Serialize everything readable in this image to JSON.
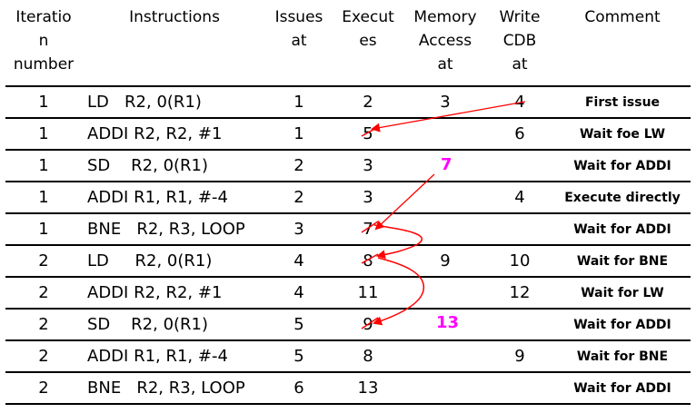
{
  "columns": [
    "Iteratio\nn\nnumber",
    "Instructions",
    "Issues\nat",
    "Execut\nes",
    "Memory\nAccess\nat",
    "Write\nCDB\nat",
    "Comment"
  ],
  "rows": [
    {
      "iter": "1",
      "instr": "LD   R2, 0(R1)",
      "issue": "1",
      "exec": "2",
      "mem": "3",
      "cdb": "4",
      "comment": "First issue"
    },
    {
      "iter": "1",
      "instr": "ADDI R2, R2, #1",
      "issue": "1",
      "exec": "5",
      "mem": "",
      "cdb": "6",
      "comment": "Wait foe LW"
    },
    {
      "iter": "1",
      "instr": "SD    R2, 0(R1)",
      "issue": "2",
      "exec": "3",
      "mem": "",
      "cdb": "",
      "comment": "Wait for ADDI"
    },
    {
      "iter": "1",
      "instr": "ADDI R1, R1, #-4",
      "issue": "2",
      "exec": "3",
      "mem": "",
      "cdb": "4",
      "comment": "Execute directly"
    },
    {
      "iter": "1",
      "instr": "BNE   R2, R3, LOOP",
      "issue": "3",
      "exec": "7",
      "mem": "",
      "cdb": "",
      "comment": "Wait for ADDI"
    },
    {
      "iter": "2",
      "instr": "LD     R2, 0(R1)",
      "issue": "4",
      "exec": "8",
      "mem": "9",
      "cdb": "10",
      "comment": "Wait for BNE"
    },
    {
      "iter": "2",
      "instr": "ADDI R2, R2, #1",
      "issue": "4",
      "exec": "11",
      "mem": "",
      "cdb": "12",
      "comment": "Wait for LW"
    },
    {
      "iter": "2",
      "instr": "SD    R2, 0(R1)",
      "issue": "5",
      "exec": "9",
      "mem": "",
      "cdb": "",
      "comment": "Wait for ADDI"
    },
    {
      "iter": "2",
      "instr": "ADDI R1, R1, #-4",
      "issue": "5",
      "exec": "8",
      "mem": "",
      "cdb": "9",
      "comment": "Wait for BNE"
    },
    {
      "iter": "2",
      "instr": "BNE   R2, R3, LOOP",
      "issue": "6",
      "exec": "13",
      "mem": "",
      "cdb": "",
      "comment": "Wait for ADDI"
    }
  ],
  "annotations": {
    "note_row3": "7",
    "note_row8": "13",
    "note_color": "#ff00ff",
    "arrow_color": "#ff0000"
  }
}
